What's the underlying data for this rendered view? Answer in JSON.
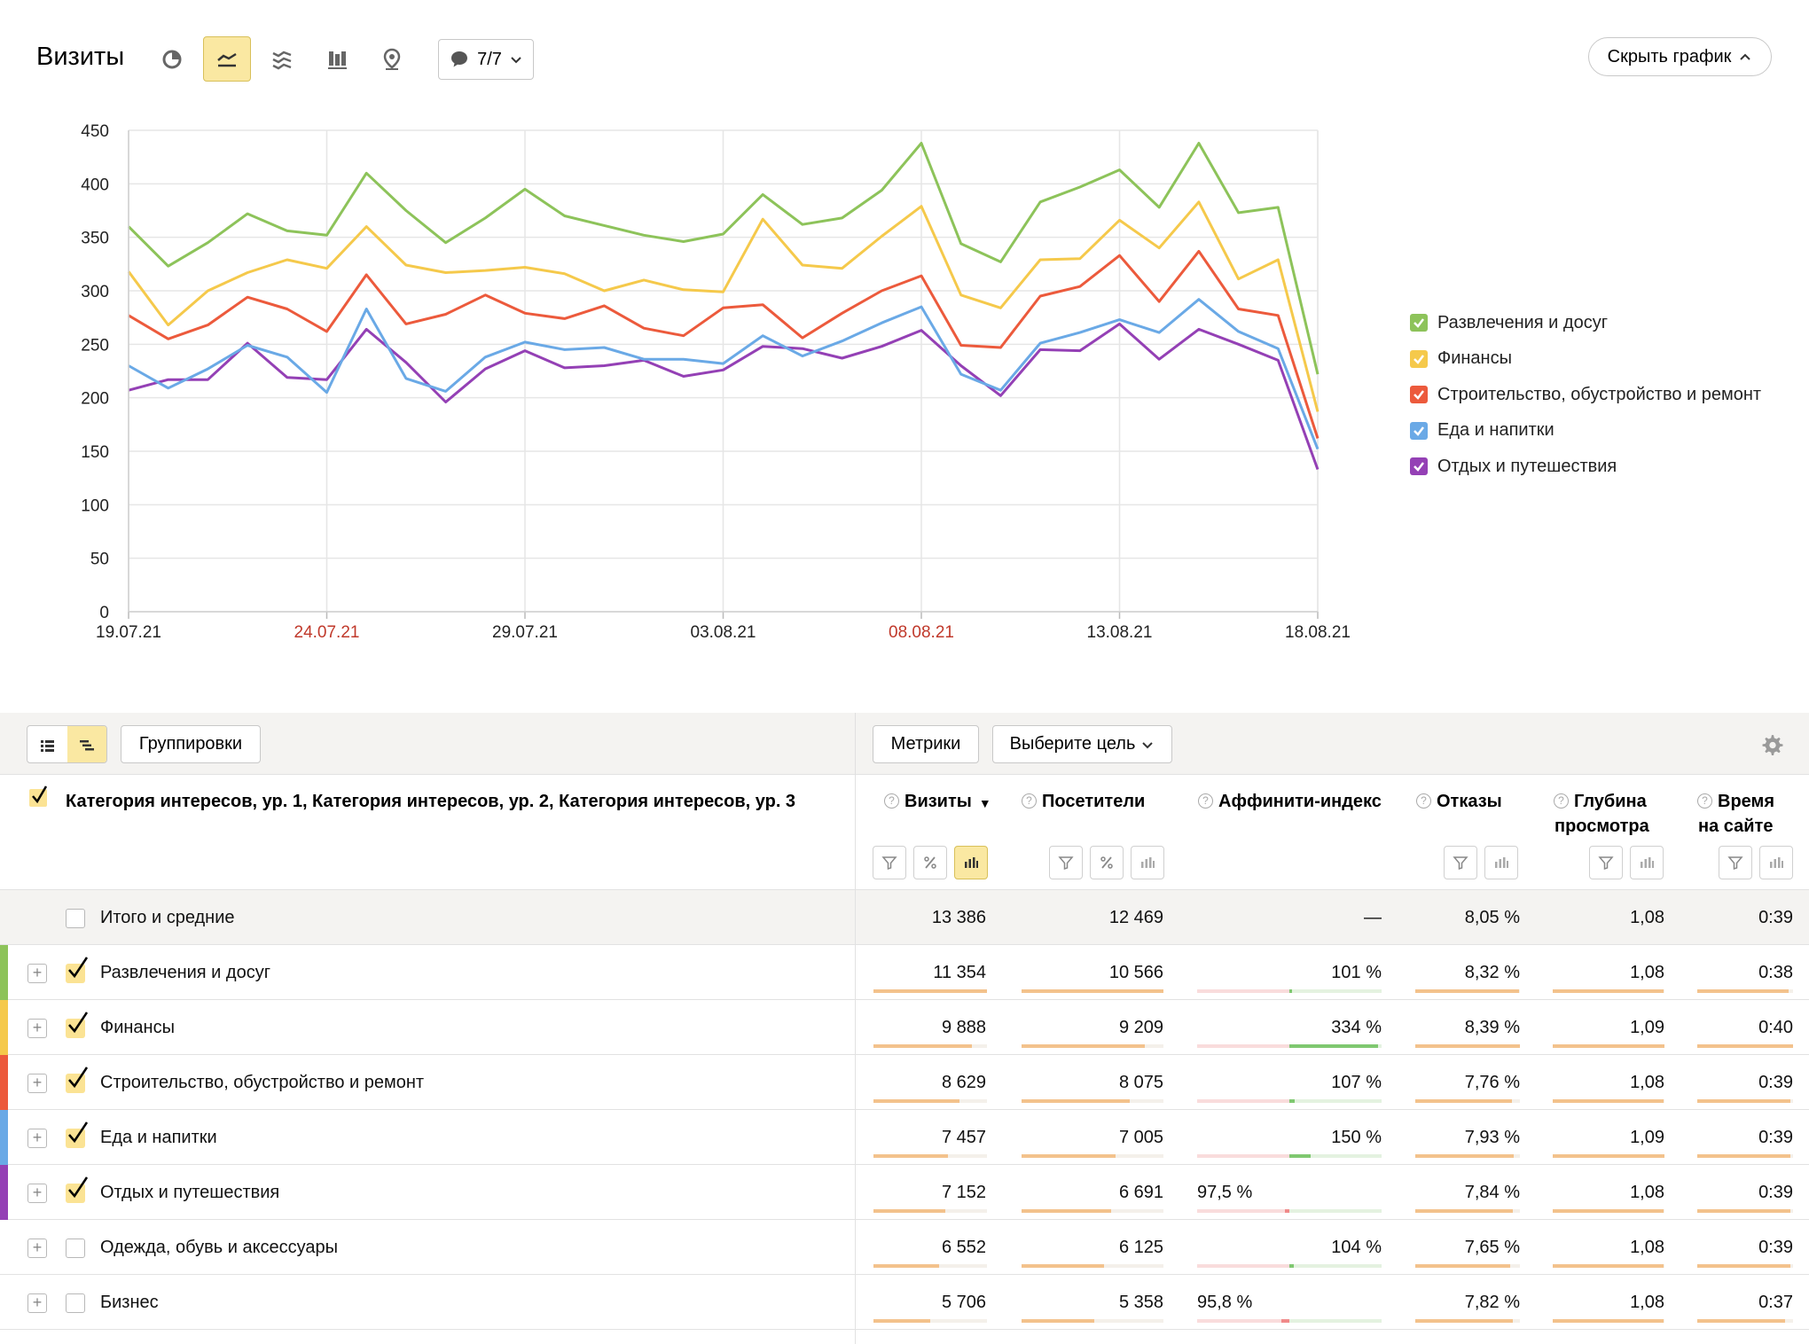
{
  "chart_header": {
    "title": "Визиты",
    "view_buttons": [
      "pie-chart-icon",
      "line-chart-icon",
      "area-chart-icon",
      "bar-chart-icon",
      "map-pin-icon"
    ],
    "active_view": "line-chart-icon",
    "comments_label": "7/7",
    "hide_chart_label": "Скрыть график"
  },
  "chart_data": {
    "type": "line",
    "title": "",
    "xlabel": "",
    "ylabel": "",
    "ylim": [
      0,
      450
    ],
    "yticks": [
      0,
      50,
      100,
      150,
      200,
      250,
      300,
      350,
      400,
      450
    ],
    "x": [
      "19.07.21",
      "20.07.21",
      "21.07.21",
      "22.07.21",
      "23.07.21",
      "24.07.21",
      "25.07.21",
      "26.07.21",
      "27.07.21",
      "28.07.21",
      "29.07.21",
      "30.07.21",
      "31.07.21",
      "01.08.21",
      "02.08.21",
      "03.08.21",
      "04.08.21",
      "05.08.21",
      "06.08.21",
      "07.08.21",
      "08.08.21",
      "09.08.21",
      "10.08.21",
      "11.08.21",
      "12.08.21",
      "13.08.21",
      "14.08.21",
      "15.08.21",
      "16.08.21",
      "17.08.21",
      "18.08.21"
    ],
    "xtick_labels": [
      {
        "label": "19.07.21",
        "index": 0,
        "color": "#222222"
      },
      {
        "label": "24.07.21",
        "index": 5,
        "color": "#c0392b"
      },
      {
        "label": "29.07.21",
        "index": 10,
        "color": "#222222"
      },
      {
        "label": "03.08.21",
        "index": 15,
        "color": "#222222"
      },
      {
        "label": "08.08.21",
        "index": 20,
        "color": "#c0392b"
      },
      {
        "label": "13.08.21",
        "index": 25,
        "color": "#222222"
      },
      {
        "label": "18.08.21",
        "index": 30,
        "color": "#222222"
      }
    ],
    "grid": true,
    "legend_position": "right",
    "series": [
      {
        "name": "Развлечения и досуг",
        "color": "#8dc35a",
        "values": [
          360,
          323,
          345,
          372,
          356,
          352,
          410,
          375,
          345,
          368,
          395,
          370,
          361,
          352,
          346,
          353,
          390,
          362,
          368,
          394,
          438,
          344,
          327,
          383,
          397,
          413,
          378,
          438,
          373,
          378,
          222
        ]
      },
      {
        "name": "Финансы",
        "color": "#f5c94b",
        "values": [
          318,
          268,
          300,
          317,
          329,
          321,
          360,
          324,
          317,
          319,
          322,
          316,
          300,
          310,
          301,
          299,
          367,
          324,
          321,
          351,
          379,
          296,
          284,
          329,
          330,
          366,
          340,
          383,
          311,
          329,
          187
        ]
      },
      {
        "name": "Строительство, обустройство и ремонт",
        "color": "#ec5a3c",
        "values": [
          277,
          255,
          268,
          294,
          283,
          262,
          315,
          269,
          278,
          296,
          279,
          274,
          286,
          265,
          258,
          284,
          287,
          256,
          279,
          300,
          314,
          249,
          247,
          295,
          304,
          333,
          290,
          337,
          283,
          277,
          162
        ]
      },
      {
        "name": "Еда и напитки",
        "color": "#6aa9e6",
        "values": [
          230,
          209,
          227,
          249,
          238,
          205,
          283,
          218,
          206,
          238,
          252,
          245,
          247,
          236,
          236,
          232,
          258,
          239,
          253,
          270,
          285,
          222,
          207,
          251,
          261,
          273,
          261,
          292,
          262,
          246,
          152
        ]
      },
      {
        "name": "Отдых и путешествия",
        "color": "#9440b5",
        "values": [
          207,
          217,
          217,
          251,
          219,
          217,
          264,
          233,
          196,
          227,
          244,
          228,
          230,
          235,
          220,
          226,
          248,
          246,
          237,
          248,
          263,
          230,
          202,
          245,
          244,
          269,
          236,
          264,
          250,
          235,
          133
        ]
      }
    ]
  },
  "toolbar": {
    "list_view_icon": "list-icon",
    "tree_view_icon": "tree-icon",
    "groupings_label": "Группировки",
    "metrics_label": "Метрики",
    "goal_label": "Выберите цель",
    "settings_icon": "gear-icon"
  },
  "table": {
    "dimension_title": "Категория интересов, ур. 1, Категория интересов, ур. 2, Категория интересов, ур. 3",
    "columns": [
      {
        "key": "visits",
        "line1": "Визиты",
        "line2": "",
        "sort": "▼"
      },
      {
        "key": "visitors",
        "line1": "Посетители",
        "line2": "",
        "sort": ""
      },
      {
        "key": "affinity",
        "line1": "Аффинити-индекс",
        "line2": "",
        "sort": ""
      },
      {
        "key": "bounce",
        "line1": "Отказы",
        "line2": "",
        "sort": ""
      },
      {
        "key": "depth",
        "line1": "Глубина",
        "line2": "просмотра",
        "sort": ""
      },
      {
        "key": "time",
        "line1": "Время",
        "line2": "на сайте",
        "sort": ""
      }
    ],
    "total": {
      "label": "Итого и средние",
      "visits": "13 386",
      "visitors": "12 469",
      "affinity": "—",
      "bounce": "8,05 %",
      "depth": "1,08",
      "time": "0:39"
    },
    "rows": [
      {
        "label": "Развлечения и досуг",
        "color": "#8dc35a",
        "checked": true,
        "visits": "11 354",
        "visitors": "10 566",
        "affinity": "101 %",
        "affinity_value": 101,
        "bounce": "8,32 %",
        "depth": "1,08",
        "time": "0:38",
        "visits_share": 1.0,
        "visitors_share": 1.0,
        "bounce_share": 0.99,
        "depth_share": 0.99,
        "time_share": 0.95
      },
      {
        "label": "Финансы",
        "color": "#f5c94b",
        "checked": true,
        "visits": "9 888",
        "visitors": "9 209",
        "affinity": "334 %",
        "affinity_value": 334,
        "bounce": "8,39 %",
        "depth": "1,09",
        "time": "0:40",
        "visits_share": 0.87,
        "visitors_share": 0.87,
        "bounce_share": 1.0,
        "depth_share": 1.0,
        "time_share": 1.0
      },
      {
        "label": "Строительство, обустройство и ремонт",
        "color": "#ec5a3c",
        "checked": true,
        "visits": "8 629",
        "visitors": "8 075",
        "affinity": "107 %",
        "affinity_value": 107,
        "bounce": "7,76 %",
        "depth": "1,08",
        "time": "0:39",
        "visits_share": 0.76,
        "visitors_share": 0.76,
        "bounce_share": 0.92,
        "depth_share": 0.99,
        "time_share": 0.97
      },
      {
        "label": "Еда и напитки",
        "color": "#6aa9e6",
        "checked": true,
        "visits": "7 457",
        "visitors": "7 005",
        "affinity": "150 %",
        "affinity_value": 150,
        "bounce": "7,93 %",
        "depth": "1,09",
        "time": "0:39",
        "visits_share": 0.66,
        "visitors_share": 0.66,
        "bounce_share": 0.94,
        "depth_share": 1.0,
        "time_share": 0.97
      },
      {
        "label": "Отдых и путешествия",
        "color": "#9440b5",
        "checked": true,
        "visits": "7 152",
        "visitors": "6 691",
        "affinity": "97,5 %",
        "affinity_value": 97.5,
        "bounce": "7,84 %",
        "depth": "1,08",
        "time": "0:39",
        "visits_share": 0.63,
        "visitors_share": 0.63,
        "bounce_share": 0.93,
        "depth_share": 0.99,
        "time_share": 0.97
      },
      {
        "label": "Одежда, обувь и аксессуары",
        "color": "",
        "checked": false,
        "visits": "6 552",
        "visitors": "6 125",
        "affinity": "104 %",
        "affinity_value": 104,
        "bounce": "7,65 %",
        "depth": "1,08",
        "time": "0:39",
        "visits_share": 0.58,
        "visitors_share": 0.58,
        "bounce_share": 0.91,
        "depth_share": 0.99,
        "time_share": 0.97
      },
      {
        "label": "Бизнес",
        "color": "",
        "checked": false,
        "visits": "5 706",
        "visitors": "5 358",
        "affinity": "95,8 %",
        "affinity_value": 95.8,
        "bounce": "7,82 %",
        "depth": "1,08",
        "time": "0:37",
        "visits_share": 0.5,
        "visitors_share": 0.51,
        "bounce_share": 0.93,
        "depth_share": 0.99,
        "time_share": 0.92
      }
    ]
  }
}
